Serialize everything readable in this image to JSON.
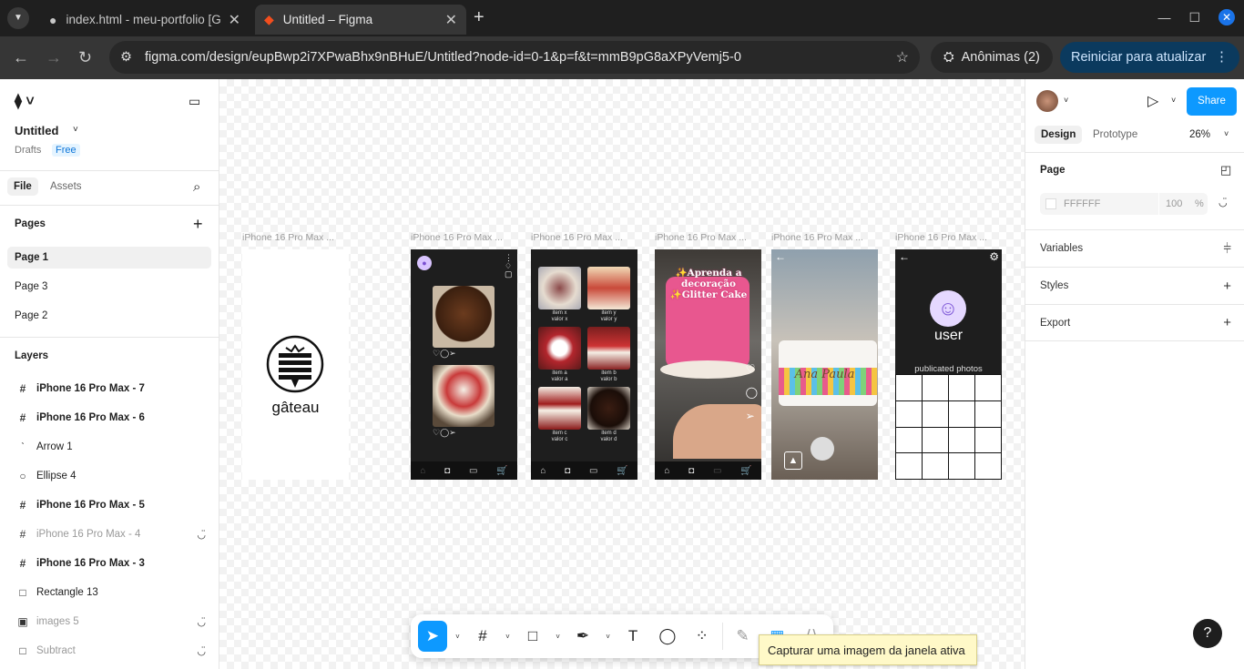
{
  "browser": {
    "tabs": [
      {
        "title": "index.html - meu-portfolio [G",
        "active": false,
        "icon": "github-icon"
      },
      {
        "title": "Untitled – Figma",
        "active": true,
        "icon": "figma-icon"
      }
    ],
    "url": "figma.com/design/eupBwp2i7XPwaBhx9nBHuE/Untitled?node-id=0-1&p=f&t=mmB9pG8aXPyVemj5-0",
    "incognito_label": "Anônimas (2)",
    "restart_label": "Reiniciar para atualizar"
  },
  "left_panel": {
    "file_name": "Untitled",
    "drafts": "Drafts",
    "plan": "Free",
    "tabs": [
      "File",
      "Assets"
    ],
    "pages_title": "Pages",
    "pages": [
      "Page 1",
      "Page 3",
      "Page 2"
    ],
    "layers_title": "Layers",
    "layers": [
      {
        "name": "iPhone 16 Pro Max - 7",
        "icon": "frame-icon",
        "bold": true,
        "hidden": false
      },
      {
        "name": "iPhone 16 Pro Max - 6",
        "icon": "frame-icon",
        "bold": true,
        "hidden": false
      },
      {
        "name": "Arrow 1",
        "icon": "arrow-icon",
        "bold": false,
        "hidden": false
      },
      {
        "name": "Ellipse 4",
        "icon": "ellipse-icon",
        "bold": false,
        "hidden": false
      },
      {
        "name": "iPhone 16 Pro Max - 5",
        "icon": "frame-icon",
        "bold": true,
        "hidden": false
      },
      {
        "name": "iPhone 16 Pro Max - 4",
        "icon": "frame-icon",
        "bold": false,
        "hidden": true
      },
      {
        "name": "iPhone 16 Pro Max - 3",
        "icon": "frame-icon",
        "bold": true,
        "hidden": false
      },
      {
        "name": "Rectangle 13",
        "icon": "rectangle-icon",
        "bold": false,
        "hidden": false
      },
      {
        "name": "images 5",
        "icon": "image-icon",
        "bold": false,
        "hidden": true
      },
      {
        "name": "Subtract",
        "icon": "rectangle-icon",
        "bold": false,
        "hidden": true
      }
    ]
  },
  "canvas": {
    "frame_label": "iPhone 16 Pro Max ...",
    "logo_text": "gâteau",
    "frame3": {
      "captions": [
        "item x\nvalor x",
        "item y\nvalor y",
        "item a\nvalor a",
        "item b\nvalor b",
        "item c\nvalor c",
        "item d\nvalor d"
      ]
    },
    "frame4": {
      "overlay_text": "✨Aprenda a decoração ✨Glitter Cake"
    },
    "frame5": {
      "cake_text": "Ana Paula"
    },
    "frame6": {
      "user_label": "user",
      "photos_label": "publicated photos"
    }
  },
  "right_panel": {
    "tabs": [
      "Design",
      "Prototype"
    ],
    "zoom": "26%",
    "share_label": "Share",
    "page_section": "Page",
    "page_color": "FFFFFF",
    "page_opacity": "100",
    "percent": "%",
    "sections": [
      "Variables",
      "Styles",
      "Export"
    ]
  },
  "toolbar": {
    "tooltip": "Capturar uma imagem da janela ativa"
  },
  "help": "?"
}
